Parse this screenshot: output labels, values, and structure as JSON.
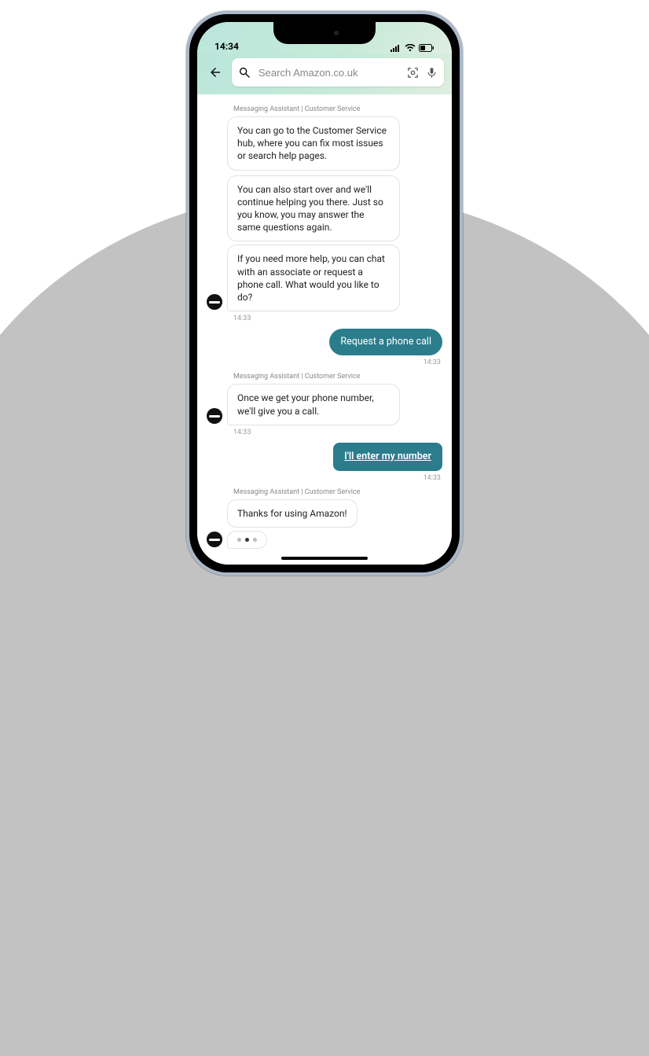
{
  "status": {
    "time": "14:34"
  },
  "search": {
    "placeholder": "Search Amazon.co.uk"
  },
  "senderLabel": "Messaging Assistant | Customer Service",
  "block1": {
    "msg1": "You can go to the Customer Service hub, where you can fix most issues or search help pages.",
    "msg2": "You can also start over and we'll continue helping you there. Just so you know, you may answer the same questions again.",
    "msg3": "If you need more help, you can chat with an associate or request a phone call. What would you like to do?",
    "timestamp": "14:33"
  },
  "user1": {
    "text": "Request a phone call",
    "timestamp": "14:33"
  },
  "block2": {
    "msg1": "Once we get your phone number, we'll give you a call.",
    "timestamp": "14:33"
  },
  "user2": {
    "text": "I'll enter my number",
    "timestamp": "14:33"
  },
  "block3": {
    "msg1": "Thanks for using Amazon!"
  }
}
